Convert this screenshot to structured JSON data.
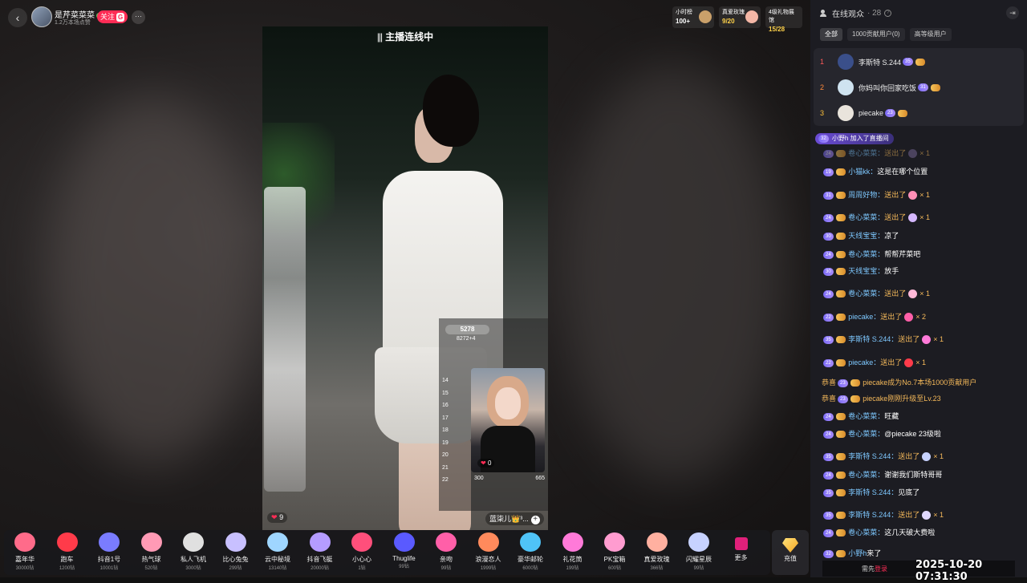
{
  "header": {
    "host_name": "是芹菜菜菜",
    "host_sub": "1.2万本场点赞",
    "follow_label": "关注",
    "follow_badge": "G",
    "more_label": "···",
    "back_icon": "back-arrow-icon",
    "ranks": [
      {
        "label": "小时榜",
        "value": "100+"
      },
      {
        "label": "真爱玫瑰",
        "value": "9/20"
      },
      {
        "label": "4级礼物展馆",
        "value": "15/28"
      }
    ]
  },
  "video": {
    "connect_label": "主播连线中",
    "pip_score": "5278",
    "pip_sub": "8272+4",
    "pip_ranks": [
      "14",
      "15",
      "16",
      "17",
      "18",
      "19",
      "20",
      "21",
      "22"
    ],
    "pip_like": "0",
    "pip_foot_left": "300",
    "pip_foot_right": "665",
    "like_count": "9",
    "pip_name": "蓝柒儿👑³..."
  },
  "gifts": [
    {
      "name": "嘉年华",
      "price": "30000钻",
      "color": "#ff6b8a",
      "icon": "carnival-icon"
    },
    {
      "name": "跑车",
      "price": "1200钻",
      "color": "#ff3b4a",
      "icon": "sportscar-icon"
    },
    {
      "name": "抖音1号",
      "price": "10001钻",
      "color": "#7a7cff",
      "icon": "rocket-icon"
    },
    {
      "name": "热气球",
      "price": "520钻",
      "color": "#ff9ab5",
      "icon": "balloon-icon"
    },
    {
      "name": "私人飞机",
      "price": "3000钻",
      "color": "#e0e0e0",
      "icon": "plane-icon"
    },
    {
      "name": "比心兔兔",
      "price": "299钻",
      "color": "#c8c0ff",
      "icon": "bunny-icon"
    },
    {
      "name": "云中秘境",
      "price": "13140钻",
      "color": "#9fd6ff",
      "icon": "cloud-castle-icon"
    },
    {
      "name": "抖音飞艇",
      "price": "20000钻",
      "color": "#b59cff",
      "icon": "airship-icon"
    },
    {
      "name": "小心心",
      "price": "1钻",
      "color": "#ff4f7b",
      "icon": "heart-icon"
    },
    {
      "name": "Thuglife",
      "price": "99钻",
      "color": "#5a5aff",
      "icon": "sunglasses-icon"
    },
    {
      "name": "亲吻",
      "price": "99钻",
      "color": "#ff5fa8",
      "icon": "kiss-icon"
    },
    {
      "name": "浪漫恋人",
      "price": "1999钻",
      "color": "#ff8a5c",
      "icon": "couple-icon"
    },
    {
      "name": "豪华邮轮",
      "price": "6000钻",
      "color": "#4fc3f7",
      "icon": "cruise-icon"
    },
    {
      "name": "礼花筒",
      "price": "199钻",
      "color": "#ff7ad9",
      "icon": "confetti-icon"
    },
    {
      "name": "PK宝箱",
      "price": "600钻",
      "color": "#ff9cd0",
      "icon": "treasure-icon"
    },
    {
      "name": "真爱玫瑰",
      "price": "366钻",
      "color": "#ffb0a0",
      "icon": "rose-icon"
    },
    {
      "name": "闪耀星辰",
      "price": "99钻",
      "color": "#c7d2ff",
      "icon": "star-icon"
    }
  ],
  "gift_more_label": "更多",
  "recharge_label": "充值",
  "panel": {
    "title": "在线观众",
    "count": "· 28",
    "filters": [
      "全部",
      "1000贡献用户(0)",
      "高等级用户"
    ],
    "viewers": [
      {
        "rank": "1",
        "name": "李斯特 S.244",
        "level": "35",
        "avatar": "#3a4f8a"
      },
      {
        "rank": "2",
        "name": "你妈叫你回家吃饭",
        "level": "31",
        "avatar": "#cfe3f0"
      },
      {
        "rank": "3",
        "name": "piecake",
        "level": "23",
        "avatar": "#e9e4dc"
      }
    ],
    "join_level": "32",
    "join_text": "小野h 加入了直播间"
  },
  "chat": [
    {
      "lvl": "24",
      "name": "卷心菜菜：",
      "text": "送出了",
      "mult": "× 1",
      "gift": "#7a6a9a",
      "faded": true
    },
    {
      "lvl": "19",
      "name": "小猫kk：",
      "text": "这是在哪个位置"
    },
    {
      "lvl": "31",
      "name": "周周好物：",
      "text": "送出了",
      "mult": "× 1",
      "gift": "#ff8fb8"
    },
    {
      "lvl": "24",
      "name": "卷心菜菜：",
      "text": "送出了",
      "mult": "× 1",
      "gift": "#d5b8ff"
    },
    {
      "lvl": "30",
      "name": "天线宝宝：",
      "text": "凉了"
    },
    {
      "lvl": "24",
      "name": "卷心菜菜：",
      "text": "帮帮芹菜吧"
    },
    {
      "lvl": "30",
      "name": "天线宝宝：",
      "text": "放手"
    },
    {
      "lvl": "24",
      "name": "卷心菜菜：",
      "text": "送出了",
      "mult": "× 1",
      "gift": "#ffb8d8"
    },
    {
      "lvl": "22",
      "name": "piecake：",
      "text": "送出了",
      "mult": "× 2",
      "gift": "#ff5fa8"
    },
    {
      "lvl": "35",
      "name": "李斯特 S.244：",
      "text": "送出了",
      "mult": "× 1",
      "gift": "#ff7ad9"
    },
    {
      "lvl": "22",
      "name": "piecake：",
      "text": "送出了",
      "mult": "× 1",
      "gift": "#ff3b4a"
    },
    {
      "prefix": "恭喜",
      "lvl": "23",
      "sys": "piecake成为No.7本场1000贡献用户"
    },
    {
      "prefix": "恭喜",
      "lvl": "23",
      "sys": "piecake刚刚升级至Lv.23"
    },
    {
      "lvl": "24",
      "name": "卷心菜菜：",
      "text": "旺藏"
    },
    {
      "lvl": "24",
      "name": "卷心菜菜：",
      "text": "@piecake 23级啦"
    },
    {
      "lvl": "35",
      "name": "李斯特 S.244：",
      "text": "送出了",
      "mult": "× 1",
      "gift": "#c7d2ff"
    },
    {
      "lvl": "24",
      "name": "卷心菜菜：",
      "text": "谢谢我们斯特哥哥"
    },
    {
      "lvl": "35",
      "name": "李斯特 S.244：",
      "text": "见底了"
    },
    {
      "lvl": "35",
      "name": "李斯特 S.244：",
      "text": "送出了",
      "mult": "× 1",
      "gift": "#e0d8ff"
    },
    {
      "lvl": "24",
      "name": "卷心菜菜：",
      "text": "这几天破大费啦"
    },
    {
      "lvl": "32",
      "name": "小野h",
      "text": "来了"
    }
  ],
  "footer": {
    "hint_pre": "需先",
    "hint_pk": "登录",
    "timestamp": "2025-10-20 07:31:30"
  }
}
